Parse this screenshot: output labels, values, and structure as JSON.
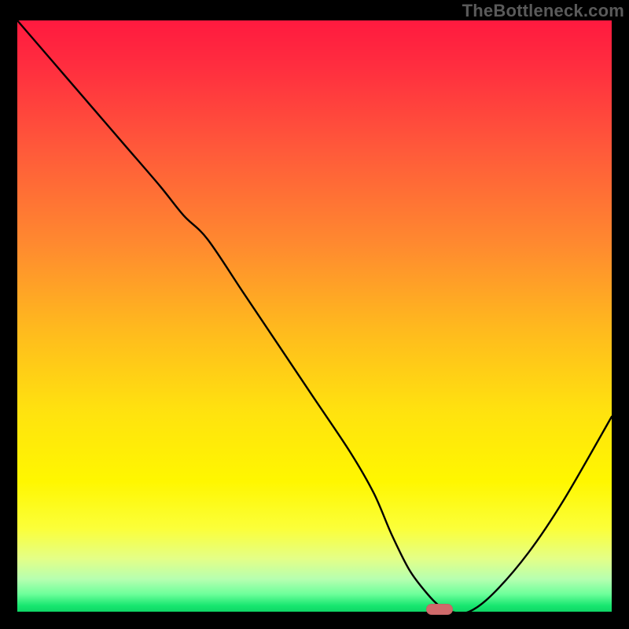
{
  "watermark": "TheBottleneck.com",
  "colors": {
    "page_bg": "#000000",
    "curve_stroke": "#000000",
    "marker_fill": "#d06a6b",
    "gradient_top": "#ff1a3f",
    "gradient_bottom": "#0fd666"
  },
  "chart_data": {
    "type": "line",
    "title": "",
    "xlabel": "",
    "ylabel": "",
    "xlim": [
      0,
      100
    ],
    "ylim": [
      0,
      100
    ],
    "grid": false,
    "legend": false,
    "note": "No axis tick labels are rendered in the source image; x/y values are estimated from pixel positions on a 0–100 scale where y=0 is the bottom (green) and y=100 is the top (red).",
    "series": [
      {
        "name": "bottleneck-curve",
        "x": [
          0,
          6,
          12,
          18,
          24,
          28,
          32,
          38,
          44,
          50,
          56,
          60,
          63,
          66,
          69,
          71,
          73,
          76,
          80,
          86,
          92,
          100
        ],
        "y": [
          100,
          93,
          86,
          79,
          72,
          67,
          63,
          54,
          45,
          36,
          27,
          20,
          13,
          7,
          3,
          1,
          0,
          0,
          3,
          10,
          19,
          33
        ]
      }
    ],
    "marker": {
      "name": "optimal-point",
      "x": 71,
      "y": 0,
      "shape": "rounded-bar"
    },
    "background_gradient": {
      "orientation": "vertical",
      "stops": [
        {
          "pos": 0.0,
          "color": "#ff1a3f"
        },
        {
          "pos": 0.22,
          "color": "#ff5a3a"
        },
        {
          "pos": 0.52,
          "color": "#ffb91e"
        },
        {
          "pos": 0.78,
          "color": "#fff700"
        },
        {
          "pos": 0.94,
          "color": "#b6ffb0"
        },
        {
          "pos": 1.0,
          "color": "#0fd666"
        }
      ]
    }
  }
}
